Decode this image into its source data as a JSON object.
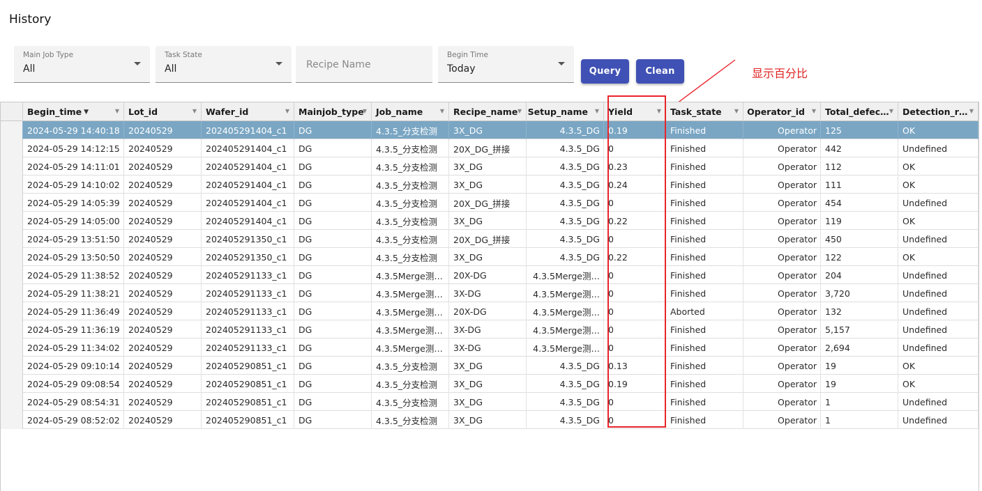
{
  "page": {
    "title": "History"
  },
  "filters": {
    "main_job_type": {
      "label": "Main Job Type",
      "value": "All"
    },
    "task_state": {
      "label": "Task State",
      "value": "All"
    },
    "recipe_name": {
      "placeholder": "Recipe Name"
    },
    "begin_time": {
      "label": "Begin Time",
      "value": "Today"
    }
  },
  "buttons": {
    "query": "Query",
    "clean": "Clean"
  },
  "annotation": {
    "text": "显示百分比",
    "color": "#e02020"
  },
  "colors": {
    "accent": "#3f51b5",
    "selected_row": "#7aa6c3",
    "annotation": "#e8242b"
  },
  "table": {
    "columns": [
      {
        "key": "begin_time",
        "label": "Begin_time",
        "sorted": "desc"
      },
      {
        "key": "lot_id",
        "label": "Lot_id"
      },
      {
        "key": "wafer_id",
        "label": "Wafer_id"
      },
      {
        "key": "mainjob_type",
        "label": "Mainjob_type"
      },
      {
        "key": "job_name",
        "label": "Job_name"
      },
      {
        "key": "recipe_name",
        "label": "Recipe_name"
      },
      {
        "key": "setup_name",
        "label": "Setup_name"
      },
      {
        "key": "yield",
        "label": "Yield"
      },
      {
        "key": "task_state",
        "label": "Task_state"
      },
      {
        "key": "operator_id",
        "label": "Operator_id"
      },
      {
        "key": "total_defects",
        "label": "Total_defec…"
      },
      {
        "key": "detection_result",
        "label": "Detection_r…"
      }
    ],
    "selected_row": 0,
    "rows": [
      [
        "2024-05-29 14:40:18",
        "20240529",
        "202405291404_c1",
        "DG",
        "4.3.5_分支检测",
        "3X_DG",
        "4.3.5_DG",
        "0.19",
        "Finished",
        "Operator",
        "125",
        "OK"
      ],
      [
        "2024-05-29 14:12:15",
        "20240529",
        "202405291404_c1",
        "DG",
        "4.3.5_分支检测",
        "20X_DG_拼接",
        "4.3.5_DG",
        "0",
        "Finished",
        "Operator",
        "442",
        "Undefined"
      ],
      [
        "2024-05-29 14:11:01",
        "20240529",
        "202405291404_c1",
        "DG",
        "4.3.5_分支检测",
        "3X_DG",
        "4.3.5_DG",
        "0.23",
        "Finished",
        "Operator",
        "112",
        "OK"
      ],
      [
        "2024-05-29 14:10:02",
        "20240529",
        "202405291404_c1",
        "DG",
        "4.3.5_分支检测",
        "3X_DG",
        "4.3.5_DG",
        "0.24",
        "Finished",
        "Operator",
        "111",
        "OK"
      ],
      [
        "2024-05-29 14:05:39",
        "20240529",
        "202405291404_c1",
        "DG",
        "4.3.5_分支检测",
        "20X_DG_拼接",
        "4.3.5_DG",
        "0",
        "Finished",
        "Operator",
        "454",
        "Undefined"
      ],
      [
        "2024-05-29 14:05:00",
        "20240529",
        "202405291404_c1",
        "DG",
        "4.3.5_分支检测",
        "3X_DG",
        "4.3.5_DG",
        "0.22",
        "Finished",
        "Operator",
        "119",
        "OK"
      ],
      [
        "2024-05-29 13:51:50",
        "20240529",
        "202405291350_c1",
        "DG",
        "4.3.5_分支检测",
        "20X_DG_拼接",
        "4.3.5_DG",
        "0",
        "Finished",
        "Operator",
        "450",
        "Undefined"
      ],
      [
        "2024-05-29 13:50:50",
        "20240529",
        "202405291350_c1",
        "DG",
        "4.3.5_分支检测",
        "3X_DG",
        "4.3.5_DG",
        "0.22",
        "Finished",
        "Operator",
        "122",
        "OK"
      ],
      [
        "2024-05-29 11:38:52",
        "20240529",
        "202405291133_c1",
        "DG",
        "4.3.5Merge测…",
        "20X-DG",
        "4.3.5Merge测…",
        "0",
        "Finished",
        "Operator",
        "204",
        "Undefined"
      ],
      [
        "2024-05-29 11:38:21",
        "20240529",
        "202405291133_c1",
        "DG",
        "4.3.5Merge测…",
        "3X-DG",
        "4.3.5Merge测…",
        "0",
        "Finished",
        "Operator",
        "3,720",
        "Undefined"
      ],
      [
        "2024-05-29 11:36:49",
        "20240529",
        "202405291133_c1",
        "DG",
        "4.3.5Merge测…",
        "20X-DG",
        "4.3.5Merge测…",
        "0",
        "Aborted",
        "Operator",
        "132",
        "Undefined"
      ],
      [
        "2024-05-29 11:36:19",
        "20240529",
        "202405291133_c1",
        "DG",
        "4.3.5Merge测…",
        "3X-DG",
        "4.3.5Merge测…",
        "0",
        "Finished",
        "Operator",
        "5,157",
        "Undefined"
      ],
      [
        "2024-05-29 11:34:02",
        "20240529",
        "202405291133_c1",
        "DG",
        "4.3.5Merge测…",
        "3X-DG",
        "4.3.5Merge测…",
        "0",
        "Finished",
        "Operator",
        "2,694",
        "Undefined"
      ],
      [
        "2024-05-29 09:10:14",
        "20240529",
        "202405290851_c1",
        "DG",
        "4.3.5_分支检测",
        "3X_DG",
        "4.3.5_DG",
        "0.13",
        "Finished",
        "Operator",
        "19",
        "OK"
      ],
      [
        "2024-05-29 09:08:54",
        "20240529",
        "202405290851_c1",
        "DG",
        "4.3.5_分支检测",
        "3X_DG",
        "4.3.5_DG",
        "0.19",
        "Finished",
        "Operator",
        "19",
        "OK"
      ],
      [
        "2024-05-29 08:54:31",
        "20240529",
        "202405290851_c1",
        "DG",
        "4.3.5_分支检测",
        "3X_DG",
        "4.3.5_DG",
        "0",
        "Finished",
        "Operator",
        "1",
        "Undefined"
      ],
      [
        "2024-05-29 08:52:02",
        "20240529",
        "202405290851_c1",
        "DG",
        "4.3.5_分支检测",
        "3X_DG",
        "4.3.5_DG",
        "0",
        "Finished",
        "Operator",
        "1",
        "Undefined"
      ]
    ]
  }
}
